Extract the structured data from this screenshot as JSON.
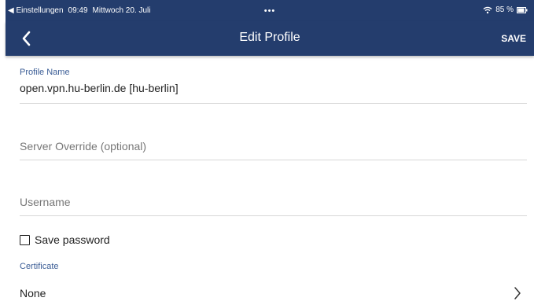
{
  "status_bar": {
    "back_app": "◀ Einstellungen",
    "time": "09:49",
    "date": "Mittwoch 20. Juli",
    "dots": "•••",
    "battery": "85 %"
  },
  "nav": {
    "title": "Edit Profile",
    "save_label": "SAVE"
  },
  "form": {
    "profile_name_label": "Profile Name",
    "profile_name_value": "open.vpn.hu-berlin.de [hu-berlin]",
    "server_override_placeholder": "Server Override (optional)",
    "username_placeholder": "Username",
    "save_password_label": "Save password",
    "save_password_checked": false,
    "certificate_label": "Certificate",
    "certificate_value": "None"
  },
  "colors": {
    "header": "#243d6d",
    "label_accent": "#3a5c95"
  }
}
